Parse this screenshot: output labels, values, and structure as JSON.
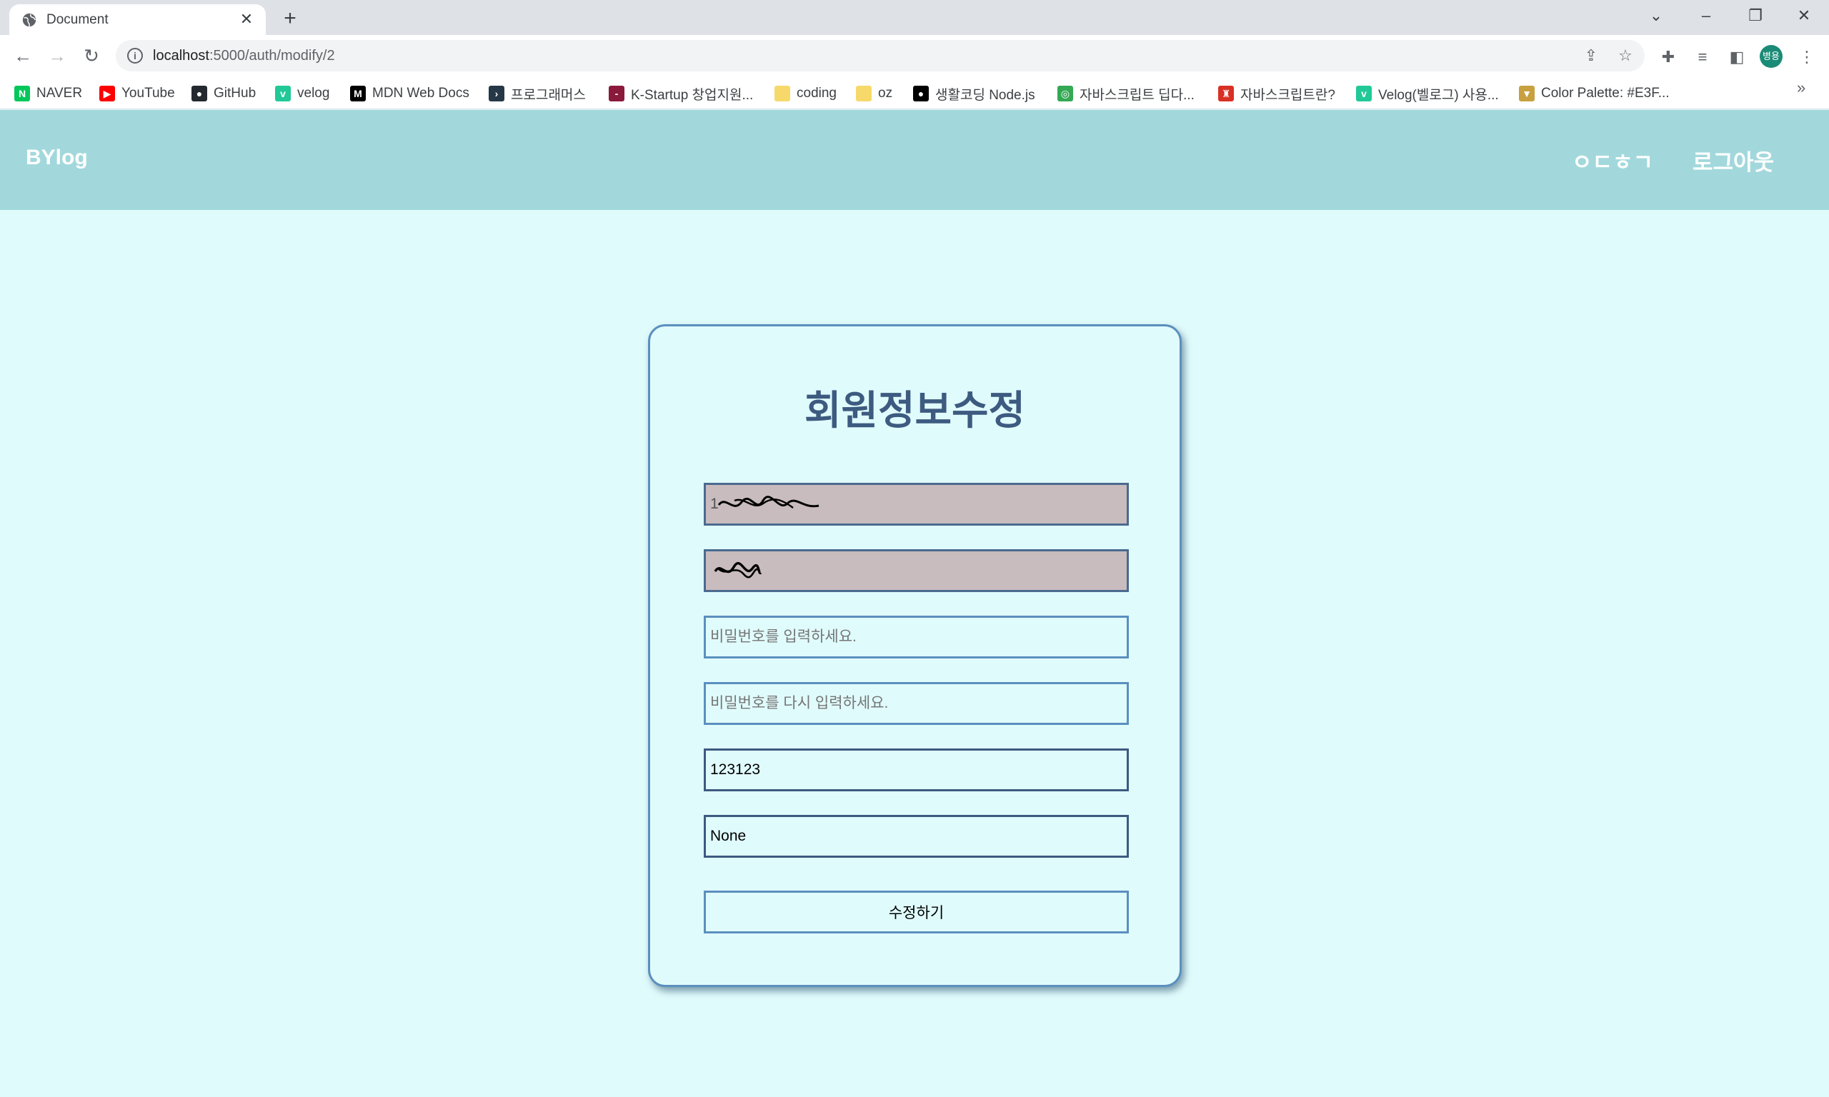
{
  "browser": {
    "tab_title": "Document",
    "url_host": "localhost",
    "url_path": ":5000/auth/modify/2",
    "profile_initials": "병용",
    "bookmarks": [
      {
        "label": "NAVER",
        "icon": "naver-icon",
        "color": "#03c75a",
        "glyph": "N"
      },
      {
        "label": "YouTube",
        "icon": "youtube-icon",
        "color": "#ff0000",
        "glyph": "▶"
      },
      {
        "label": "GitHub",
        "icon": "github-icon",
        "color": "#24292f",
        "glyph": "●"
      },
      {
        "label": "velog",
        "icon": "velog-icon",
        "color": "#20c997",
        "glyph": "v"
      },
      {
        "label": "MDN Web Docs",
        "icon": "mdn-icon",
        "color": "#000000",
        "glyph": "M"
      },
      {
        "label": "프로그래머스",
        "icon": "programmers-icon",
        "color": "#263747",
        "glyph": "›"
      },
      {
        "label": "K-Startup 창업지원...",
        "icon": "kstartup-icon",
        "color": "#8a1a3c",
        "glyph": "-"
      },
      {
        "label": "coding",
        "icon": "folder-icon",
        "color": "#f7d96b",
        "glyph": ""
      },
      {
        "label": "oz",
        "icon": "folder-icon",
        "color": "#f7d96b",
        "glyph": ""
      },
      {
        "label": "생활코딩 Node.js",
        "icon": "opentutorials-icon",
        "color": "#000000",
        "glyph": "●"
      },
      {
        "label": "자바스크립트 딥다...",
        "icon": "site-icon",
        "color": "#34a853",
        "glyph": "◎"
      },
      {
        "label": "자바스크립트란?",
        "icon": "tower-icon",
        "color": "#d93025",
        "glyph": "♜"
      },
      {
        "label": "Velog(벨로그) 사용...",
        "icon": "velog-icon",
        "color": "#20c997",
        "glyph": "v"
      },
      {
        "label": "Color Palette: #E3F...",
        "icon": "cup-icon",
        "color": "#c8a040",
        "glyph": "▼"
      }
    ]
  },
  "site": {
    "logo": "BYlog",
    "nav": {
      "write": "ㅇㄷㅎㄱ",
      "logout": "로그아웃"
    }
  },
  "form": {
    "title": "회원정보수정",
    "email_value": "1",
    "nickname_value": "",
    "password_placeholder": "비밀번호를 입력하세요.",
    "password_confirm_placeholder": "비밀번호를 다시 입력하세요.",
    "phone_value": "123123",
    "extra_value": "None",
    "submit_label": "수정하기"
  },
  "colors": {
    "header_bg": "#a2d8dc",
    "page_bg": "#e0fbfc",
    "title_color": "#3d5a80",
    "disabled_bg": "#c9bcbe"
  }
}
